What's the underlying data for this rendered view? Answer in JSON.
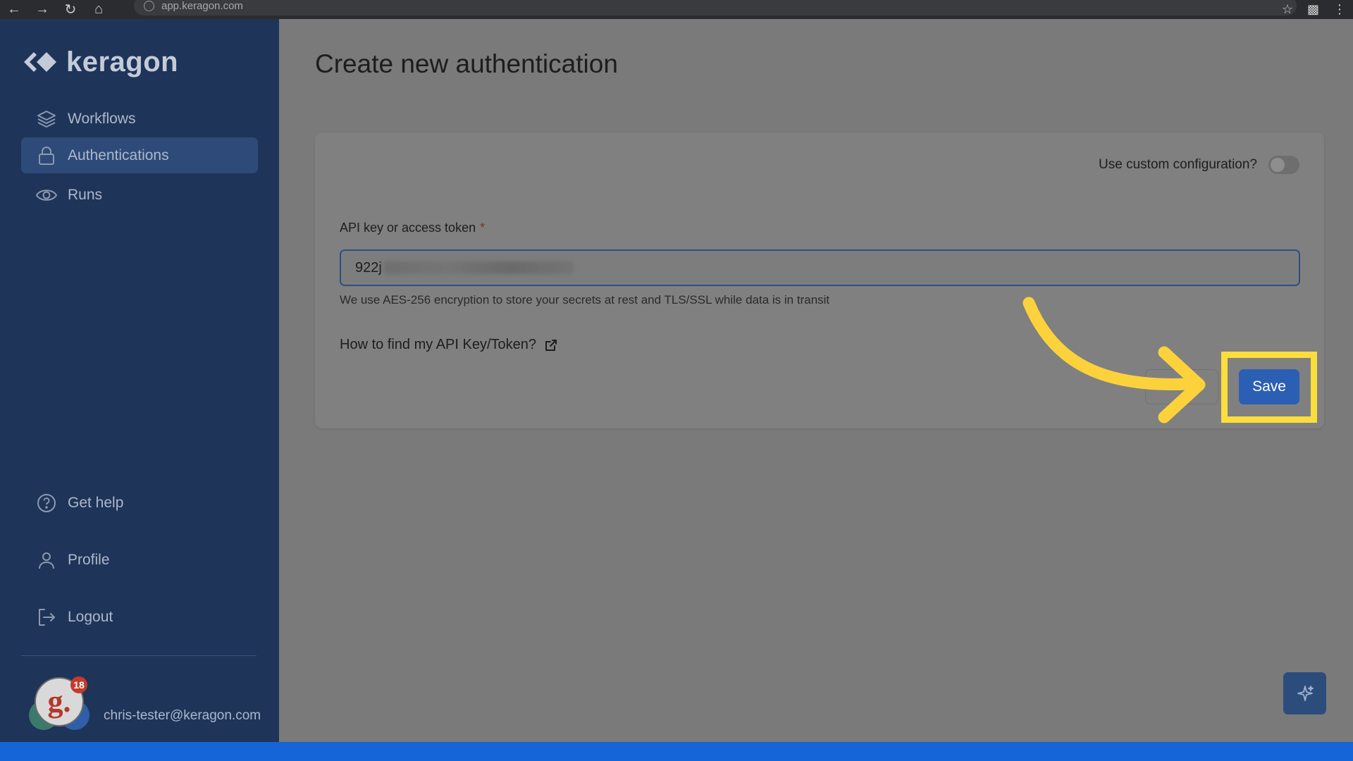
{
  "browser": {
    "url": "app.keragon.com"
  },
  "brand": {
    "name": "keragon"
  },
  "sidebar": {
    "items": [
      {
        "label": "Workflows",
        "icon": "layers-icon",
        "active": false
      },
      {
        "label": "Authentications",
        "icon": "lock-icon",
        "active": true
      },
      {
        "label": "Runs",
        "icon": "eye-icon",
        "active": false
      }
    ],
    "bottom_items": [
      {
        "label": "Get help",
        "icon": "help-circle-icon"
      },
      {
        "label": "Profile",
        "icon": "user-icon"
      },
      {
        "label": "Logout",
        "icon": "logout-icon"
      }
    ],
    "user": {
      "email": "chris-tester@keragon.com",
      "avatar_letter": "g.",
      "notification_count": "18"
    }
  },
  "main": {
    "title": "Create new authentication",
    "custom_config_label": "Use custom configuration?",
    "custom_config_enabled": false,
    "api_field": {
      "label": "API key or access token",
      "required_marker": "*",
      "value_visible": "922j"
    },
    "helper_text": "We use AES-256 encryption to store your secrets at rest and TLS/SSL while data is in transit",
    "howto_link": "How to find my API Key/Token?",
    "save_label": "Save"
  },
  "colors": {
    "sidebar_bg": "#1e3459",
    "active_item_bg": "#2d4a78",
    "primary_button": "#2b5fb4",
    "highlight": "#fbde3b",
    "bottom_strip": "#1565d8"
  }
}
